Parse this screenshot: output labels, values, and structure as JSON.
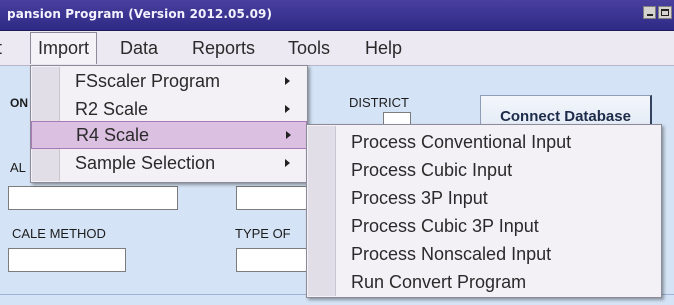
{
  "window": {
    "title": "pansion Program (Version 2012.05.09)"
  },
  "menubar": {
    "items": [
      {
        "label": "t"
      },
      {
        "label": "Import"
      },
      {
        "label": "Data"
      },
      {
        "label": "Reports"
      },
      {
        "label": "Tools"
      },
      {
        "label": "Help"
      }
    ]
  },
  "form": {
    "label_on": "ON",
    "label_district": "DISTRICT",
    "label_al": "AL",
    "label_scale_method": "CALE METHOD",
    "label_type_of": "TYPE OF",
    "connect_button": "Connect Database"
  },
  "import_menu": {
    "items": [
      {
        "label": "FSscaler Program",
        "has_submenu": true
      },
      {
        "label": "R2 Scale",
        "has_submenu": true
      },
      {
        "label": "R4 Scale",
        "has_submenu": true,
        "highlighted": true
      },
      {
        "label": "Sample Selection",
        "has_submenu": true
      }
    ]
  },
  "r4_submenu": {
    "items": [
      {
        "label": "Process Conventional Input"
      },
      {
        "label": "Process Cubic Input"
      },
      {
        "label": "Process 3P Input"
      },
      {
        "label": "Process Cubic 3P Input"
      },
      {
        "label": "Process Nonscaled Input"
      },
      {
        "label": "Run Convert Program"
      }
    ]
  },
  "colors": {
    "titlebar": "#2e2a86",
    "background": "#d4e3f5",
    "highlight": "#dcc0e2"
  }
}
